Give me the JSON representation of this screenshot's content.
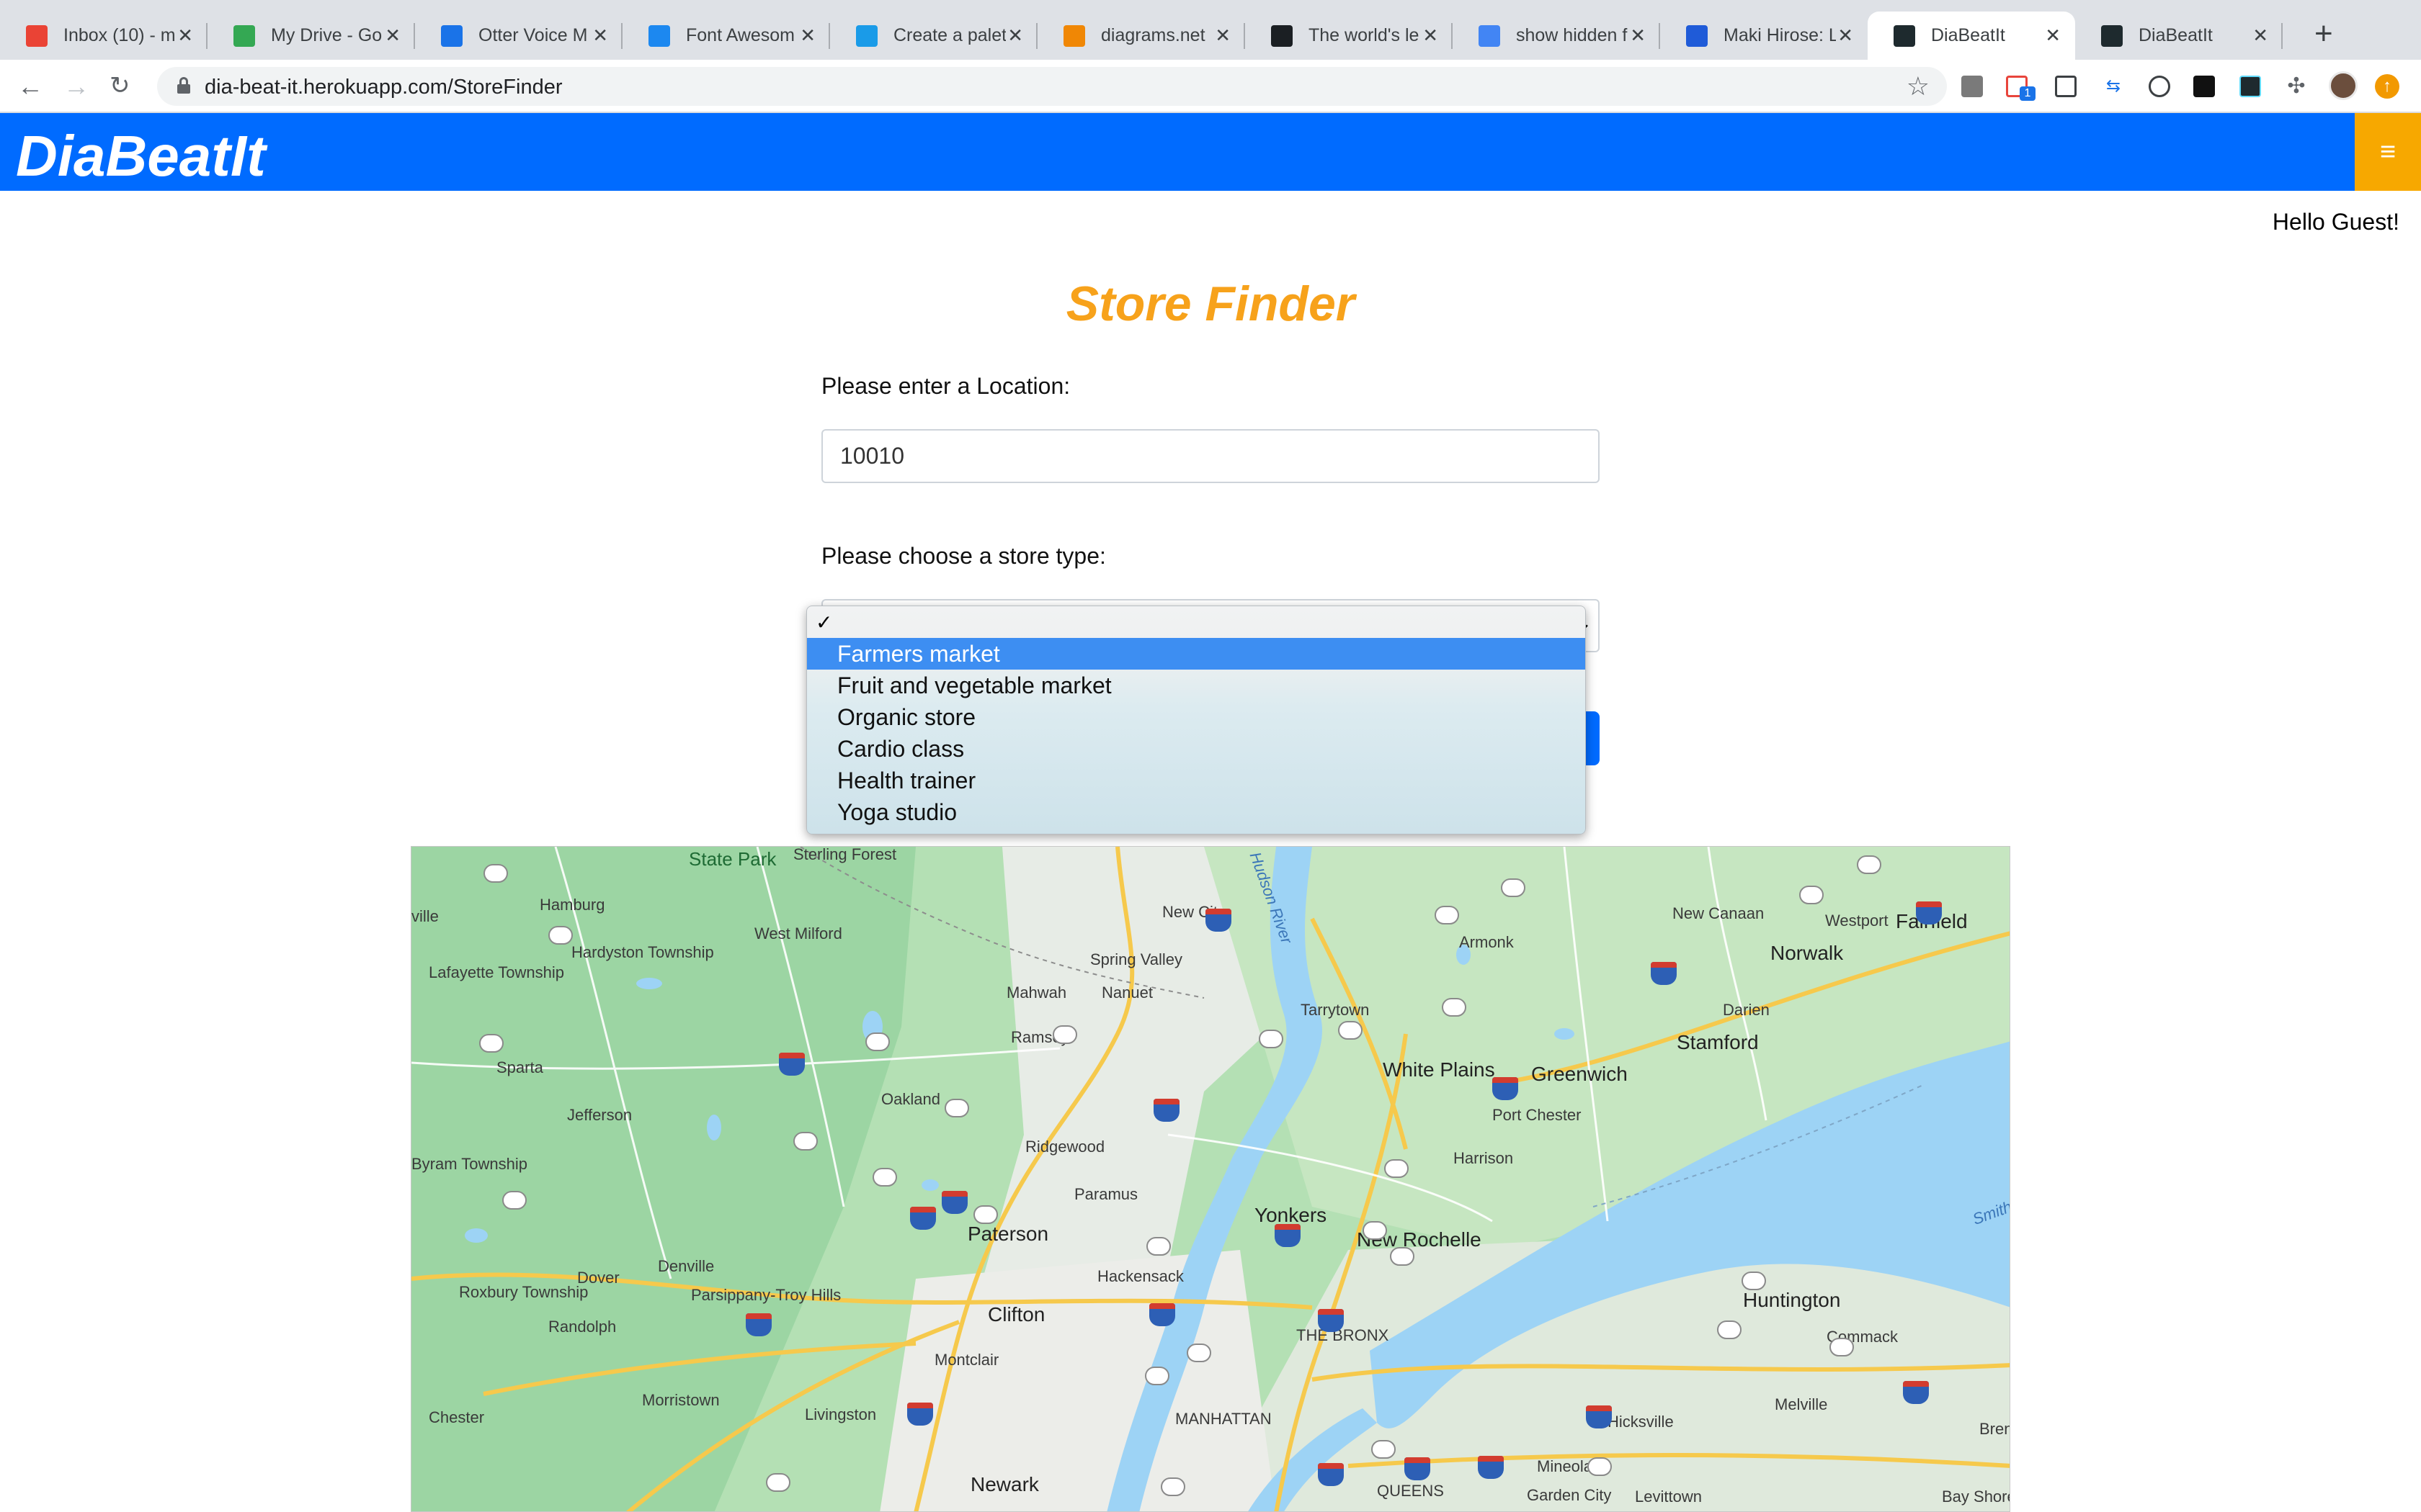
{
  "browser": {
    "tabs": [
      {
        "title": "Inbox (10) - m",
        "icon": "gmail-icon",
        "color": "#ea4335"
      },
      {
        "title": "My Drive - Go",
        "icon": "drive-icon",
        "color": "#34a853"
      },
      {
        "title": "Otter Voice M",
        "icon": "otter-icon",
        "color": "#1a73e8"
      },
      {
        "title": "Font Awesom",
        "icon": "flag-icon",
        "color": "#1c88f0"
      },
      {
        "title": "Create a palet",
        "icon": "canva-icon",
        "color": "#1a9be8"
      },
      {
        "title": "diagrams.net",
        "icon": "diagrams-icon",
        "color": "#f08705"
      },
      {
        "title": "The world's le",
        "icon": "github-icon",
        "color": "#1b1f23"
      },
      {
        "title": "show hidden f",
        "icon": "google-icon",
        "color": "#4285f4"
      },
      {
        "title": "Maki Hirose: L",
        "icon": "square-icon",
        "color": "#1f5bd8"
      },
      {
        "title": "DiaBeatIt",
        "icon": "react-icon",
        "color": "#1e2a2e"
      },
      {
        "title": "DiaBeatIt",
        "icon": "react-icon",
        "color": "#1e2a2e"
      }
    ],
    "active_tab": 9,
    "url": "dia-beat-it.herokuapp.com/StoreFinder",
    "extension_badge": "1"
  },
  "app": {
    "brand": "DiaBeatIt",
    "menu_icon": "≡",
    "greeting": "Hello Guest!",
    "title": "Store Finder",
    "location_label": "Please enter a Location:",
    "location_value": "10010",
    "store_type_label": "Please choose a store type:",
    "dropdown": {
      "checkmark": "✓",
      "options": [
        "Farmers market",
        "Fruit and vegetable market",
        "Organic store",
        "Cardio class",
        "Health trainer",
        "Yoga studio"
      ],
      "highlighted_index": 0
    }
  },
  "map": {
    "places": [
      {
        "name": "State Park"
      },
      {
        "name": "Sterling Forest"
      },
      {
        "name": "Hamburg"
      },
      {
        "name": "ville"
      },
      {
        "name": "Lafayette Township"
      },
      {
        "name": "Hardyston Township"
      },
      {
        "name": "West Milford"
      },
      {
        "name": "New City"
      },
      {
        "name": "Spring Valley"
      },
      {
        "name": "Mahwah"
      },
      {
        "name": "Nanuet"
      },
      {
        "name": "Ramsey"
      },
      {
        "name": "Tarrytown"
      },
      {
        "name": "Armonk"
      },
      {
        "name": "New Canaan"
      },
      {
        "name": "Westport"
      },
      {
        "name": "Fairfield"
      },
      {
        "name": "Norwalk"
      },
      {
        "name": "Darien"
      },
      {
        "name": "Stamford"
      },
      {
        "name": "Sparta"
      },
      {
        "name": "Jefferson"
      },
      {
        "name": "Oakland"
      },
      {
        "name": "Ridgewood"
      },
      {
        "name": "White Plains"
      },
      {
        "name": "Greenwich"
      },
      {
        "name": "Port Chester"
      },
      {
        "name": "Harrison"
      },
      {
        "name": "Byram Township"
      },
      {
        "name": "Paramus"
      },
      {
        "name": "Paterson"
      },
      {
        "name": "Yonkers"
      },
      {
        "name": "New Rochelle"
      },
      {
        "name": "Hackensack"
      },
      {
        "name": "Dover"
      },
      {
        "name": "Denville"
      },
      {
        "name": "Parsippany-Troy Hills"
      },
      {
        "name": "Roxbury Township"
      },
      {
        "name": "Randolph"
      },
      {
        "name": "Clifton"
      },
      {
        "name": "THE BRONX"
      },
      {
        "name": "Montclair"
      },
      {
        "name": "Huntington"
      },
      {
        "name": "Commack"
      },
      {
        "name": "Morristown"
      },
      {
        "name": "Livingston"
      },
      {
        "name": "MANHATTAN"
      },
      {
        "name": "Melville"
      },
      {
        "name": "Chester"
      },
      {
        "name": "Hicksville"
      },
      {
        "name": "Mineola"
      },
      {
        "name": "Newark"
      },
      {
        "name": "QUEENS"
      },
      {
        "name": "Garden City"
      },
      {
        "name": "Levittown"
      },
      {
        "name": "Bay Shore"
      },
      {
        "name": "Brentwood"
      },
      {
        "name": "Smith"
      },
      {
        "name": "Hudson River"
      }
    ]
  }
}
